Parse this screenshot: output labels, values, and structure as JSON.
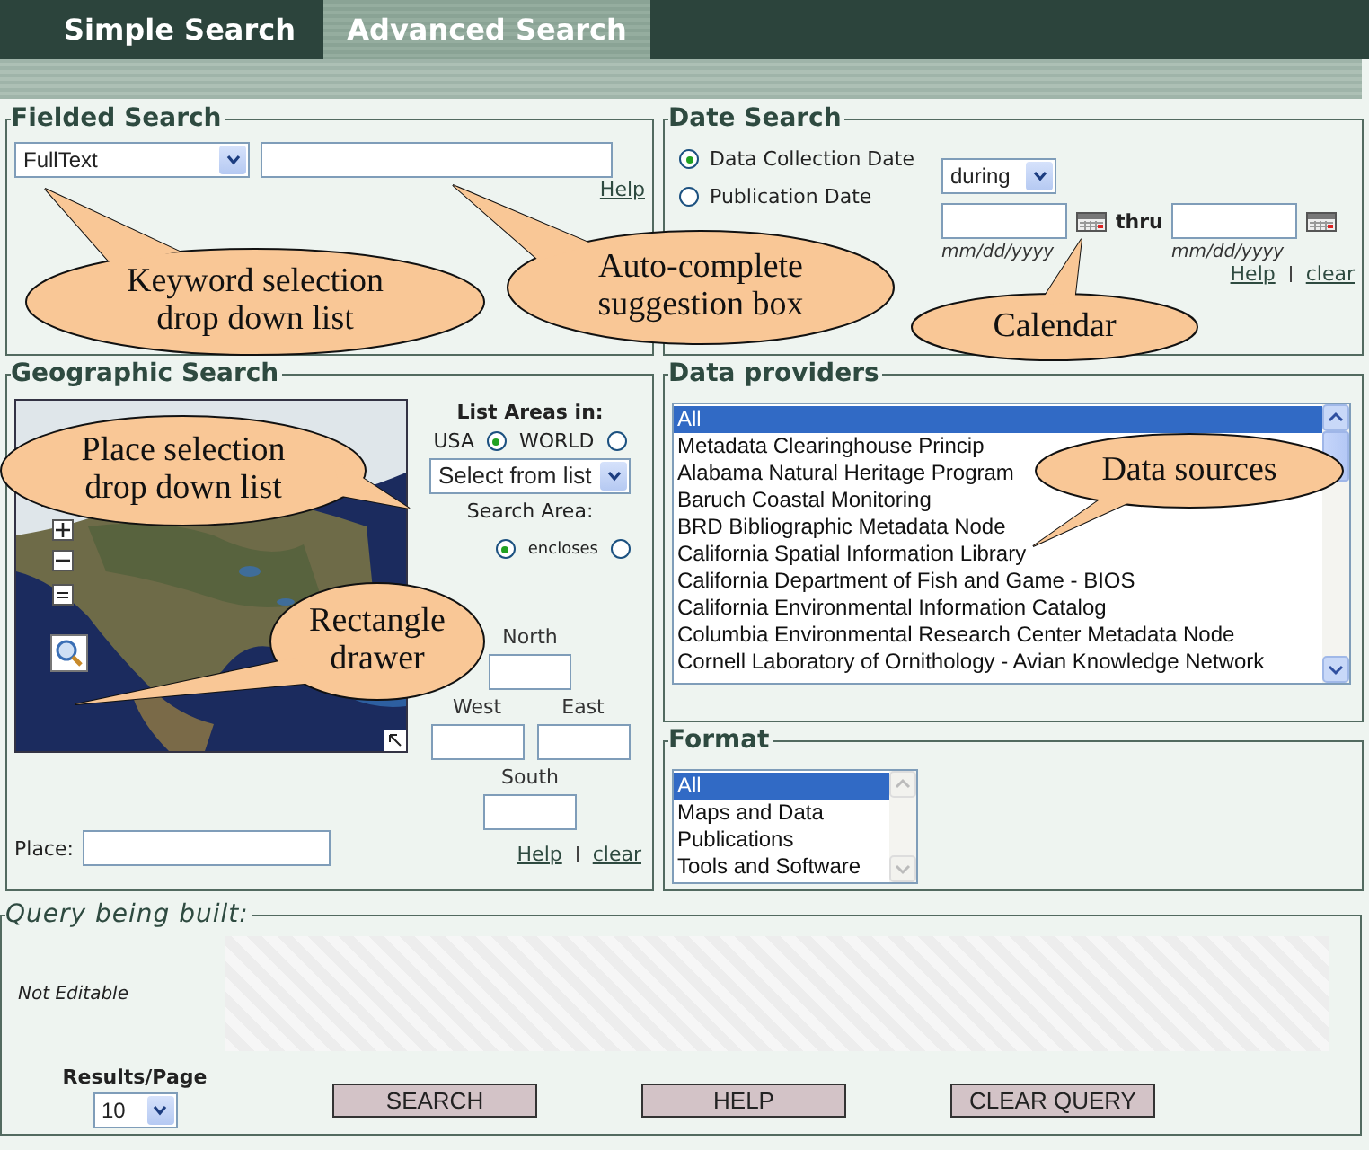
{
  "tabs": [
    {
      "label": "Simple Search",
      "selected": false
    },
    {
      "label": "Advanced Search",
      "selected": true
    }
  ],
  "fielded_search": {
    "title": "Fielded Search",
    "field_select": "FullText",
    "links": [
      "Help"
    ]
  },
  "date_search": {
    "title": "Date Search",
    "date_types": [
      {
        "label": "Data Collection Date",
        "selected": true
      },
      {
        "label": "Publication Date",
        "selected": false
      }
    ],
    "range_select": "during",
    "from_hint": "mm/dd/yyyy",
    "thru_label": "thru",
    "to_hint": "mm/dd/yyyy",
    "links": [
      "Help",
      "clear"
    ]
  },
  "geographic_search": {
    "title": "Geographic Search",
    "list_areas_label": "List Areas in:",
    "regions": [
      {
        "label": "USA",
        "selected": true
      },
      {
        "label": "WORLD",
        "selected": false
      }
    ],
    "area_select": "Select from list",
    "search_area_label": "Search Area:",
    "search_modes": [
      {
        "selected": true
      },
      {
        "label": "encloses",
        "selected": false
      }
    ],
    "north_label": "North",
    "west_label": "West",
    "east_label": "East",
    "south_label": "South",
    "place_label": "Place:",
    "links": [
      "Help",
      "clear"
    ]
  },
  "data_providers": {
    "title": "Data providers",
    "items": [
      {
        "label": "All",
        "selected": true
      },
      {
        "label": "Metadata Clearinghouse Princip",
        "selected": false
      },
      {
        "label": "Alabama Natural Heritage Program",
        "selected": false
      },
      {
        "label": "Baruch Coastal Monitoring",
        "selected": false
      },
      {
        "label": "BRD Bibliographic Metadata Node",
        "selected": false
      },
      {
        "label": "California Spatial Information Library",
        "selected": false
      },
      {
        "label": "California Department of Fish and Game - BIOS",
        "selected": false
      },
      {
        "label": "California Environmental Information Catalog",
        "selected": false
      },
      {
        "label": "Columbia Environmental Research Center Metadata Node",
        "selected": false
      },
      {
        "label": "Cornell Laboratory of Ornithology - Avian Knowledge Network",
        "selected": false
      }
    ]
  },
  "format": {
    "title": "Format",
    "items": [
      {
        "label": "All",
        "selected": true
      },
      {
        "label": "Maps and Data",
        "selected": false
      },
      {
        "label": "Publications",
        "selected": false
      },
      {
        "label": "Tools and Software",
        "selected": false
      }
    ]
  },
  "query": {
    "title": "Query being built:",
    "note": "Not Editable",
    "results_label": "Results/Page",
    "results_select": "10",
    "buttons": [
      "SEARCH",
      "HELP",
      "CLEAR QUERY"
    ]
  },
  "callouts": [
    {
      "text": "Keyword selection drop down list"
    },
    {
      "text": "Auto-complete suggestion box"
    },
    {
      "text": "Calendar"
    },
    {
      "text": "Place selection drop down list"
    },
    {
      "text": "Rectangle drawer"
    },
    {
      "text": "Data sources"
    }
  ]
}
